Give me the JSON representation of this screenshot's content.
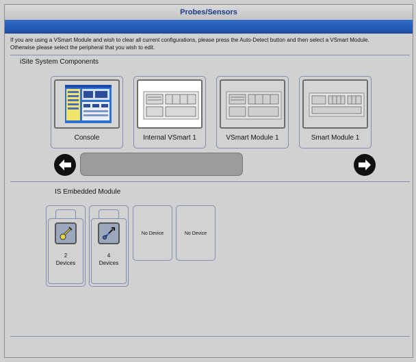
{
  "window": {
    "title": "Probes/Sensors"
  },
  "instructions": {
    "line1": "If you are using a VSmart Module and wish to clear all current configurations, please press the Auto-Detect button and then select a VSmart Module.",
    "line2": "Otherwise please select the peripheral that you wish to edit."
  },
  "system_components": {
    "heading": "iSite System Components",
    "items": [
      {
        "label": "Console",
        "icon": "console-screen-icon",
        "selected": false
      },
      {
        "label": "Internal VSmart 1",
        "icon": "vsmart-panel-icon",
        "selected": true
      },
      {
        "label": "VSmart Module 1",
        "icon": "vsmart-panel-icon",
        "selected": false
      },
      {
        "label": "Smart Module 1",
        "icon": "smart-module-panel-icon",
        "selected": false
      }
    ],
    "nav": {
      "prev_icon": "arrow-left-icon",
      "next_icon": "arrow-right-icon"
    }
  },
  "embedded_module": {
    "heading": "IS Embedded Module",
    "slots": [
      {
        "icon": "probe-yellow-icon",
        "count": "2",
        "unit": "Devices"
      },
      {
        "icon": "probe-blue-icon",
        "count": "4",
        "unit": "Devices"
      },
      {
        "label": "No Device"
      },
      {
        "label": "No Device"
      }
    ]
  },
  "colors": {
    "title_text": "#1b3a8c",
    "blue_bar": "#1e4fa8",
    "background": "#d1d1d1"
  }
}
